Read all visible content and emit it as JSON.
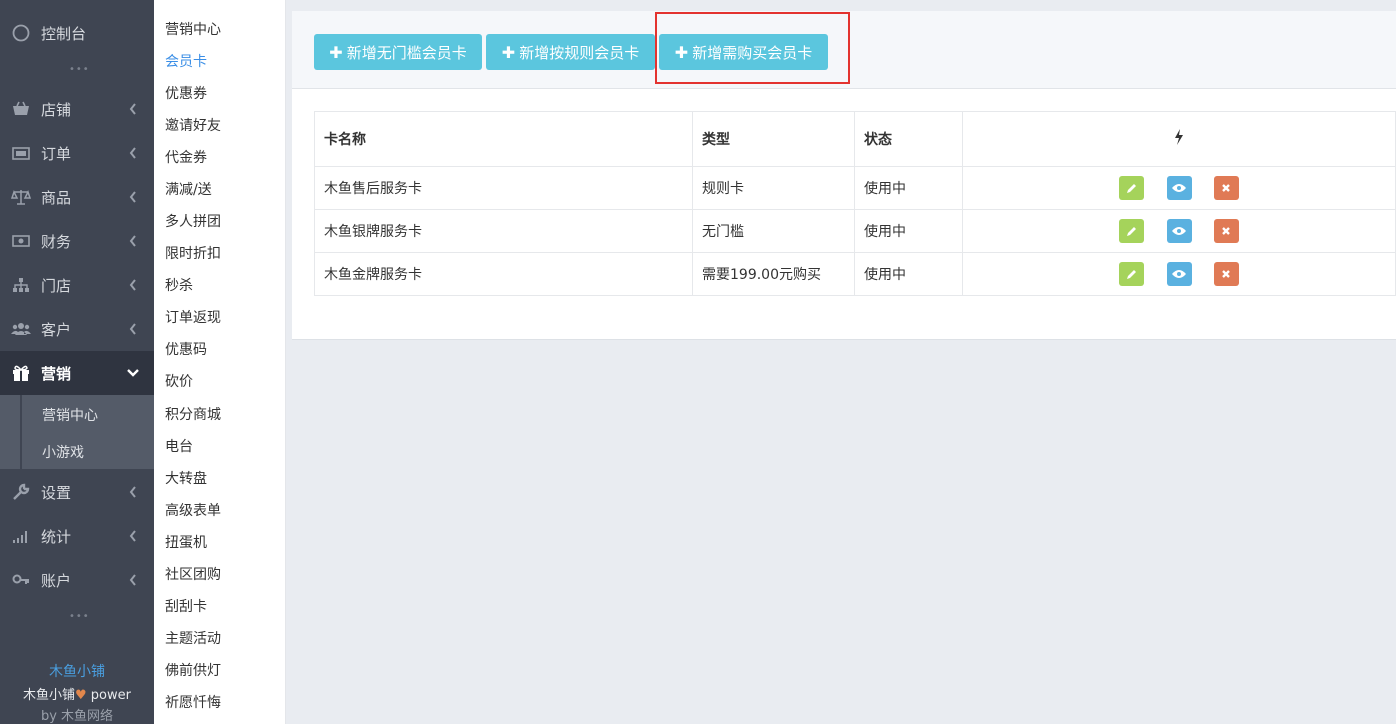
{
  "nav": {
    "items": [
      {
        "label": "控制台",
        "icon": "dashboard-icon"
      },
      {
        "label": "店铺",
        "icon": "shop-icon"
      },
      {
        "label": "订单",
        "icon": "order-icon"
      },
      {
        "label": "商品",
        "icon": "scale-icon"
      },
      {
        "label": "财务",
        "icon": "money-icon"
      },
      {
        "label": "门店",
        "icon": "sitemap-icon"
      },
      {
        "label": "客户",
        "icon": "users-icon"
      },
      {
        "label": "营销",
        "icon": "gift-icon"
      },
      {
        "label": "设置",
        "icon": "wrench-icon"
      },
      {
        "label": "统计",
        "icon": "signal-icon"
      },
      {
        "label": "账户",
        "icon": "key-icon"
      }
    ],
    "sub_items": [
      "营销中心",
      "小游戏"
    ],
    "footer": {
      "brand": "木鱼小铺",
      "power_prefix": "木鱼小铺",
      "power_suffix": " power",
      "by": "by 木鱼网络"
    }
  },
  "submenu": {
    "items": [
      "营销中心",
      "会员卡",
      "优惠券",
      "邀请好友",
      "代金券",
      "满减/送",
      "多人拼团",
      "限时折扣",
      "秒杀",
      "订单返现",
      "优惠码",
      "砍价",
      "积分商城",
      "电台",
      "大转盘",
      "高级表单",
      "扭蛋机",
      "社区团购",
      "刮刮卡",
      "主题活动",
      "佛前供灯",
      "祈愿忏悔"
    ],
    "active": "会员卡"
  },
  "toolbar": {
    "buttons": [
      "新增无门槛会员卡",
      "新增按规则会员卡",
      "新增需购买会员卡"
    ]
  },
  "table": {
    "headers": [
      "卡名称",
      "类型",
      "状态"
    ],
    "rows": [
      {
        "name": "木鱼售后服务卡",
        "type": "规则卡",
        "status": "使用中"
      },
      {
        "name": "木鱼银牌服务卡",
        "type": "无门槛",
        "status": "使用中"
      },
      {
        "name": "木鱼金牌服务卡",
        "type": "需要199.00元购买",
        "status": "使用中"
      }
    ]
  },
  "colors": {
    "nav_bg": "#3f4552",
    "accent": "#5bc6de",
    "active_link": "#3a8ee6",
    "edit": "#a5d35b",
    "view": "#5ab1e0",
    "delete": "#e07a55",
    "highlight": "#e3332f"
  }
}
